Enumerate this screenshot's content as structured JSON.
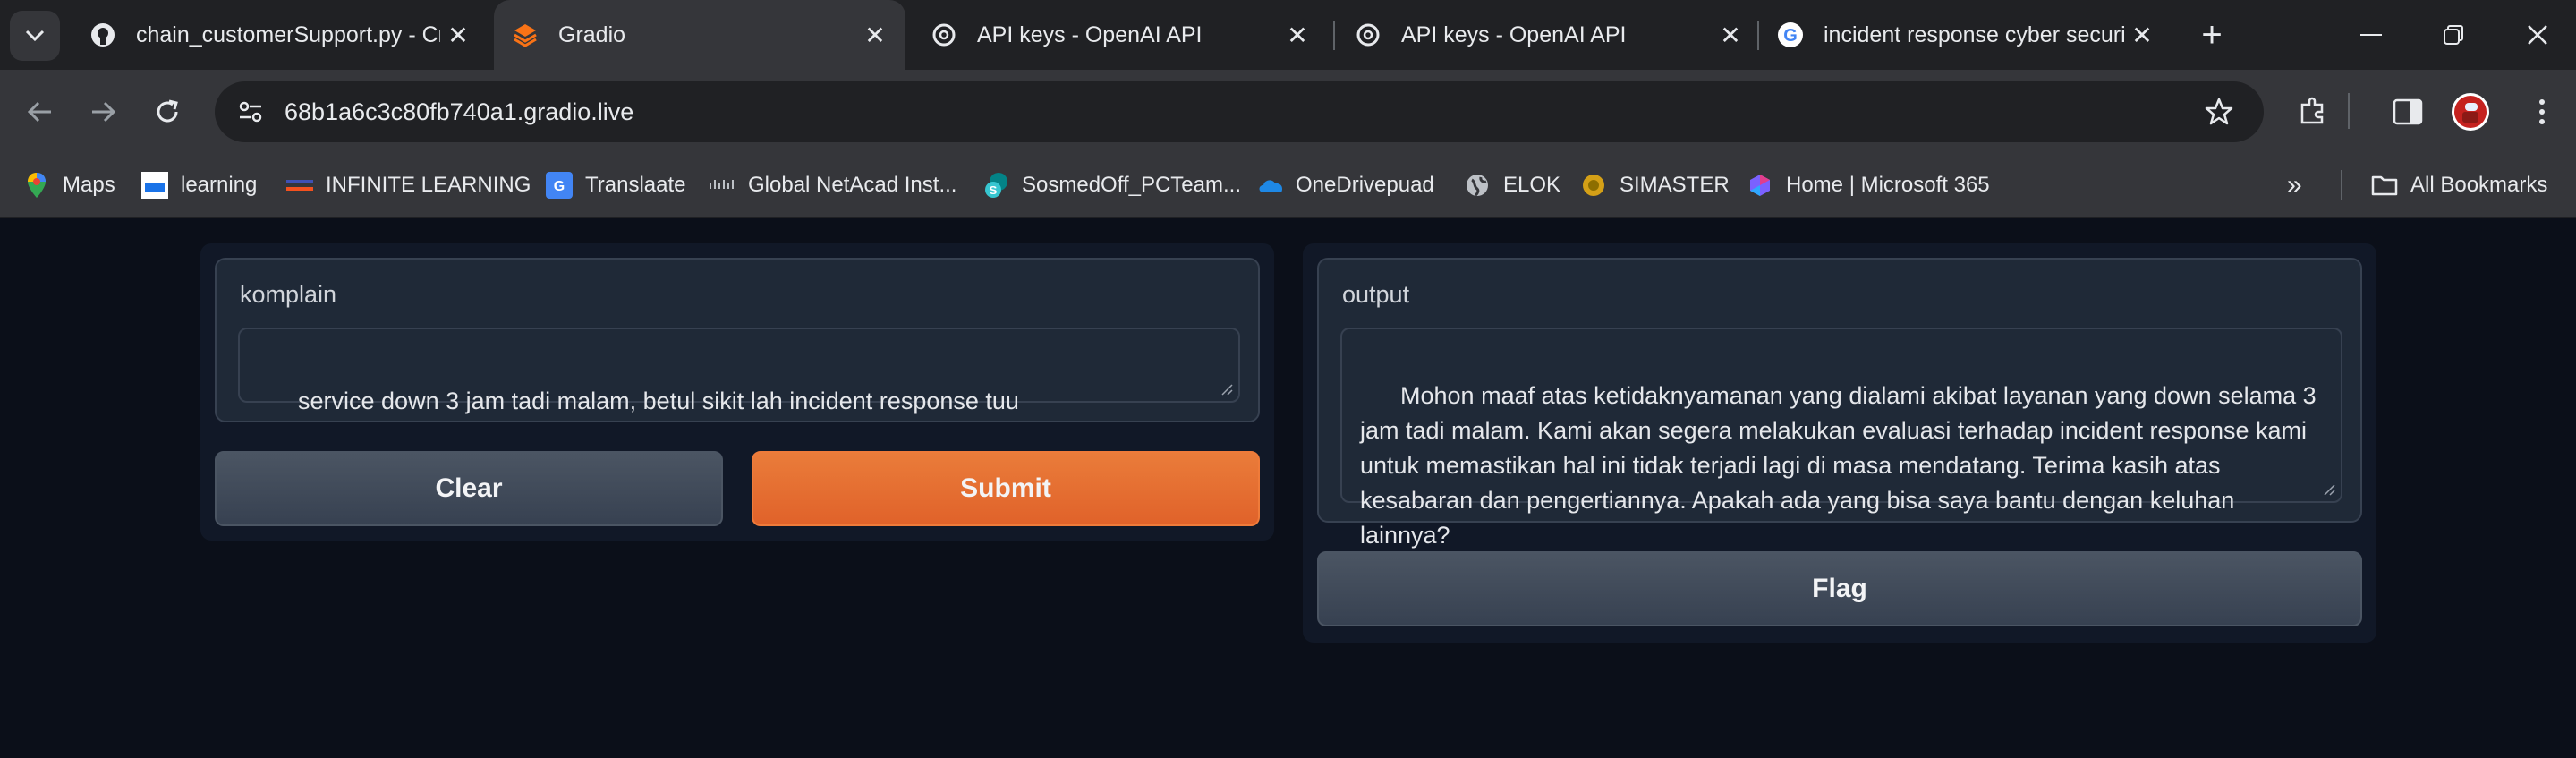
{
  "browser": {
    "tabs": [
      {
        "title": "chain_customerSupport.py - Cr",
        "active": false,
        "favicon": "github-icon"
      },
      {
        "title": "Gradio",
        "active": true,
        "favicon": "gradio-icon"
      },
      {
        "title": "API keys - OpenAI API",
        "active": false,
        "favicon": "openai-icon"
      },
      {
        "title": "API keys - OpenAI API",
        "active": false,
        "favicon": "openai-icon"
      },
      {
        "title": "incident response cyber securit",
        "active": false,
        "favicon": "google-icon"
      }
    ],
    "url": "68b1a6c3c80fb740a1.gradio.live",
    "bookmarks": [
      {
        "label": "Maps",
        "icon": "maps-icon"
      },
      {
        "label": "learning",
        "icon": "learning-icon"
      },
      {
        "label": "INFINITE LEARNING",
        "icon": "infinite-learning-icon"
      },
      {
        "label": "Translaate",
        "icon": "translate-icon"
      },
      {
        "label": "Global NetAcad Inst...",
        "icon": "cisco-icon"
      },
      {
        "label": "SosmedOff_PCTeam...",
        "icon": "sharepoint-icon"
      },
      {
        "label": "OneDrivepuad",
        "icon": "onedrive-icon"
      },
      {
        "label": "ELOK",
        "icon": "globe-icon"
      },
      {
        "label": "SIMASTER",
        "icon": "simaster-icon"
      },
      {
        "label": "Home | Microsoft 365",
        "icon": "microsoft365-icon"
      }
    ],
    "all_bookmarks_label": "All Bookmarks"
  },
  "app": {
    "input": {
      "label": "komplain",
      "value": "service down 3 jam tadi malam, betul sikit lah incident response tuu"
    },
    "clear_label": "Clear",
    "submit_label": "Submit",
    "output": {
      "label": "output",
      "value": "Mohon maaf atas ketidaknyamanan yang dialami akibat layanan yang down selama 3 jam tadi malam. Kami akan segera melakukan evaluasi terhadap incident response kami untuk memastikan hal ini tidak terjadi lagi di masa mendatang. Terima kasih atas kesabaran dan pengertiannya. Apakah ada yang bisa saya bantu dengan keluhan lainnya?"
    },
    "flag_label": "Flag"
  },
  "colors": {
    "background": "#0b0f19",
    "panel": "#111827",
    "block": "#1f2937",
    "primary": "#e8702f",
    "secondary": "#4b5563"
  }
}
